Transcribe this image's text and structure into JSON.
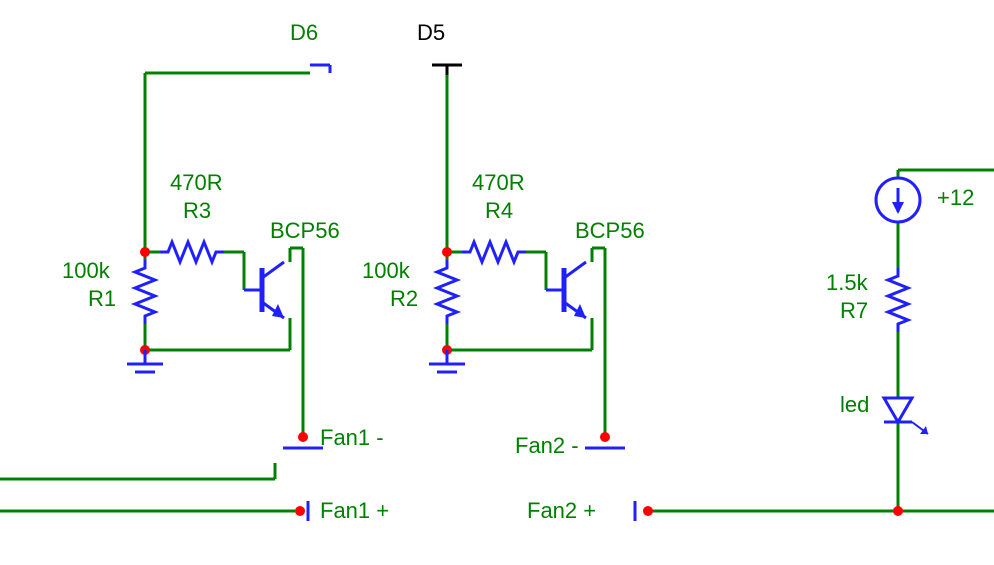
{
  "nets": {
    "d6": "D6",
    "d5": "D5",
    "fan1_neg": "Fan1 -",
    "fan1_pos": "Fan1 +",
    "fan2_neg": "Fan2 -",
    "fan2_pos": "Fan2 +",
    "vplus": "+12"
  },
  "components": {
    "r1": {
      "ref": "R1",
      "value": "100k"
    },
    "r2": {
      "ref": "R2",
      "value": "100k"
    },
    "r3": {
      "ref": "R3",
      "value": "470R"
    },
    "r4": {
      "ref": "R4",
      "value": "470R"
    },
    "r7": {
      "ref": "R7",
      "value": "1.5k"
    },
    "q1": {
      "type": "BCP56"
    },
    "q2": {
      "type": "BCP56"
    },
    "d_led": {
      "ref": "led"
    }
  },
  "chart_data": {
    "type": "schematic",
    "description": "Transistor fan-driver circuit with LED indicator",
    "blocks": [
      {
        "name": "Fan1 driver",
        "input": "D6",
        "transistor": "BCP56",
        "base_resistor": {
          "ref": "R3",
          "value": "470R"
        },
        "pulldown_resistor": {
          "ref": "R1",
          "value": "100k"
        },
        "output_neg": "Fan1 -",
        "output_pos": "Fan1 +"
      },
      {
        "name": "Fan2 driver",
        "input": "D5",
        "transistor": "BCP56",
        "base_resistor": {
          "ref": "R4",
          "value": "470R"
        },
        "pulldown_resistor": {
          "ref": "R2",
          "value": "100k"
        },
        "output_neg": "Fan2 -",
        "output_pos": "Fan2 +"
      },
      {
        "name": "LED indicator",
        "source": "+12V current source",
        "series_resistor": {
          "ref": "R7",
          "value": "1.5k"
        },
        "diode": "led",
        "sink": "Fan2 + rail"
      }
    ]
  }
}
